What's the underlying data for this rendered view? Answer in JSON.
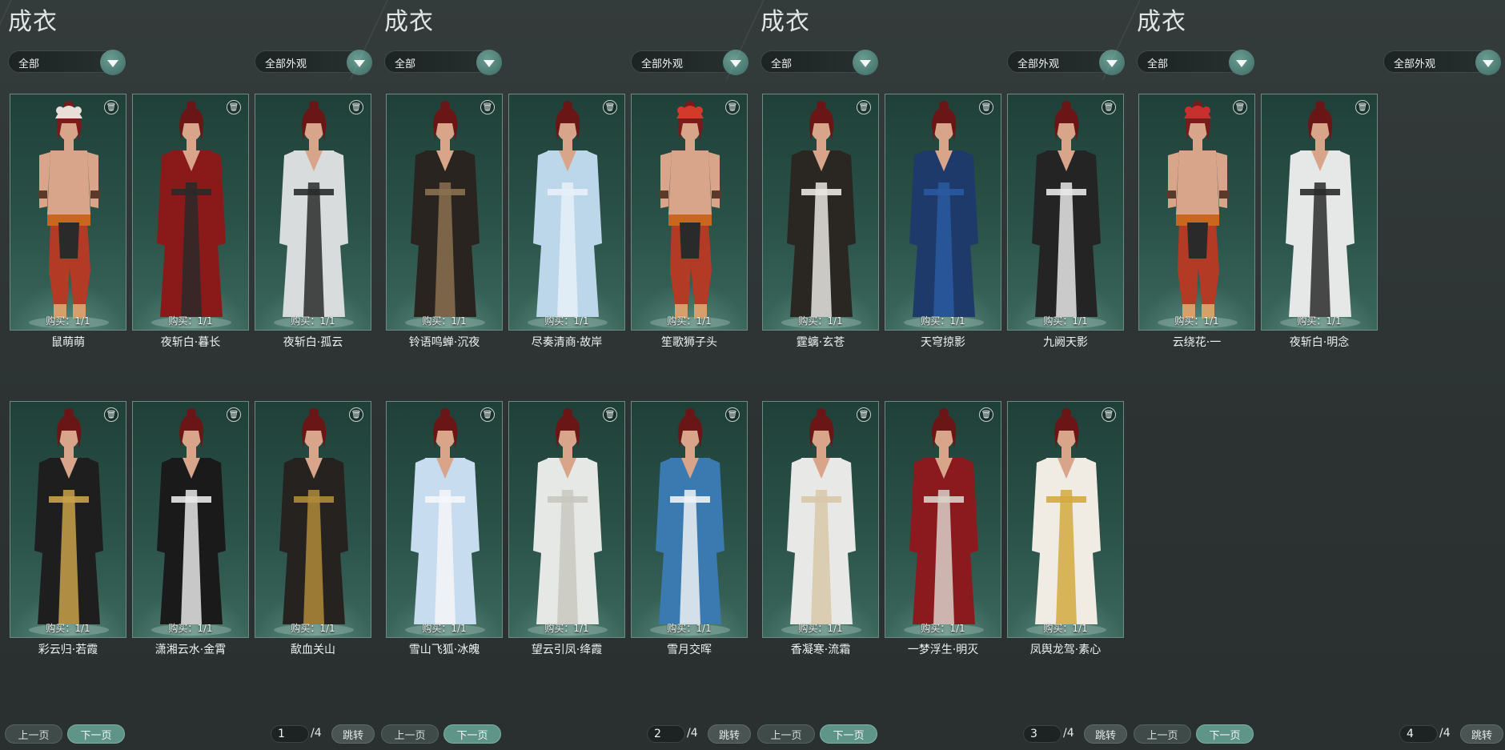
{
  "panels": [
    {
      "title": "成衣",
      "filter_all": "全部",
      "filter_look": "全部外观",
      "cards": [
        {
          "name": "鼠萌萌",
          "buy": "购买：1/1",
          "hair": "#7a1a1a",
          "body": "#b33a24",
          "accent": "#d6a06b",
          "shirtless": true,
          "hat": "#e8e0d8"
        },
        {
          "name": "夜斩白·暮长",
          "buy": "购买：1/1",
          "hair": "#6a1616",
          "body": "#8a1a1a",
          "accent": "#2a2a2a"
        },
        {
          "name": "夜斩白·孤云",
          "buy": "购买：1/1",
          "hair": "#6a1616",
          "body": "#d8dcdc",
          "accent": "#2a2a2a"
        },
        {
          "name": "彩云归·若霞",
          "buy": "购买：1/1",
          "hair": "#6a1616",
          "body": "#1e1e1e",
          "accent": "#c9a24a"
        },
        {
          "name": "潇湘云水·金霄",
          "buy": "购买：1/1",
          "hair": "#6a1616",
          "body": "#1a1a1a",
          "accent": "#e8e8e8"
        },
        {
          "name": "歃血关山",
          "buy": "购买：1/1",
          "hair": "#6a1616",
          "body": "#262220",
          "accent": "#b08a3a"
        }
      ],
      "page": "1",
      "total": "/4",
      "prev": "上一页",
      "next": "下一页",
      "jump": "跳转"
    },
    {
      "title": "成衣",
      "filter_all": "全部",
      "filter_look": "全部外观",
      "cards": [
        {
          "name": "铃语鸣蝉·沉夜",
          "buy": "购买：1/1",
          "hair": "#6a1616",
          "body": "#2a2420",
          "accent": "#8a7050"
        },
        {
          "name": "尽奏清商·故岸",
          "buy": "购买：1/1",
          "hair": "#6a1616",
          "body": "#bcd6ea",
          "accent": "#e6f0f8"
        },
        {
          "name": "笙歌狮子头",
          "buy": "购买：1/1",
          "hair": "#7a1a1a",
          "body": "#b33a24",
          "accent": "#d6a06b",
          "shirtless": true,
          "hat": "#d43a2a"
        },
        {
          "name": "雪山飞狐·冰魄",
          "buy": "购买：1/1",
          "hair": "#6a1616",
          "body": "#c8dcf0",
          "accent": "#f4f6f8"
        },
        {
          "name": "望云引凤·绛霞",
          "buy": "购买：1/1",
          "hair": "#6a1616",
          "body": "#e6e8e6",
          "accent": "#c8c8c0"
        },
        {
          "name": "雪月交晖",
          "buy": "购买：1/1",
          "hair": "#6a1616",
          "body": "#3a7ab0",
          "accent": "#eef2f4"
        }
      ],
      "page": "2",
      "total": "/4",
      "prev": "上一页",
      "next": "下一页",
      "jump": "跳转"
    },
    {
      "title": "成衣",
      "filter_all": "全部",
      "filter_look": "全部外观",
      "cards": [
        {
          "name": "霆螭·玄苍",
          "buy": "购买：1/1",
          "hair": "#6a1616",
          "body": "#2a2622",
          "accent": "#e8e6e2"
        },
        {
          "name": "天穹掠影",
          "buy": "购买：1/1",
          "hair": "#6a1616",
          "body": "#1e3a6a",
          "accent": "#2a5aa0"
        },
        {
          "name": "九阙天影",
          "buy": "购买：1/1",
          "hair": "#6a1616",
          "body": "#242424",
          "accent": "#e8e8e8"
        },
        {
          "name": "香凝寒·流霜",
          "buy": "购买：1/1",
          "hair": "#6a1616",
          "body": "#e8e8e6",
          "accent": "#d8c8a8"
        },
        {
          "name": "一梦浮生·明灭",
          "buy": "购买：1/1",
          "hair": "#6a1616",
          "body": "#8a1a1e",
          "accent": "#d8d0c8"
        },
        {
          "name": "凤舆龙驾·素心",
          "buy": "购买：1/1",
          "hair": "#6a1616",
          "body": "#f0ece4",
          "accent": "#d4aa40"
        }
      ],
      "page": "3",
      "total": "/4",
      "prev": "上一页",
      "next": "下一页",
      "jump": "跳转"
    },
    {
      "title": "成衣",
      "filter_all": "全部",
      "filter_look": "全部外观",
      "cards": [
        {
          "name": "云绕花·一",
          "buy": "购买：1/1",
          "hair": "#7a1a1a",
          "body": "#b33a24",
          "accent": "#d6a06b",
          "shirtless": true,
          "hat": "#c83030"
        },
        {
          "name": "夜斩白·明念",
          "buy": "购买：1/1",
          "hair": "#6a1616",
          "body": "#e6e8e8",
          "accent": "#2a2a2a"
        }
      ],
      "page": "4",
      "total": "/4",
      "prev": "上一页",
      "next": "下一页",
      "jump": "跳转"
    }
  ]
}
